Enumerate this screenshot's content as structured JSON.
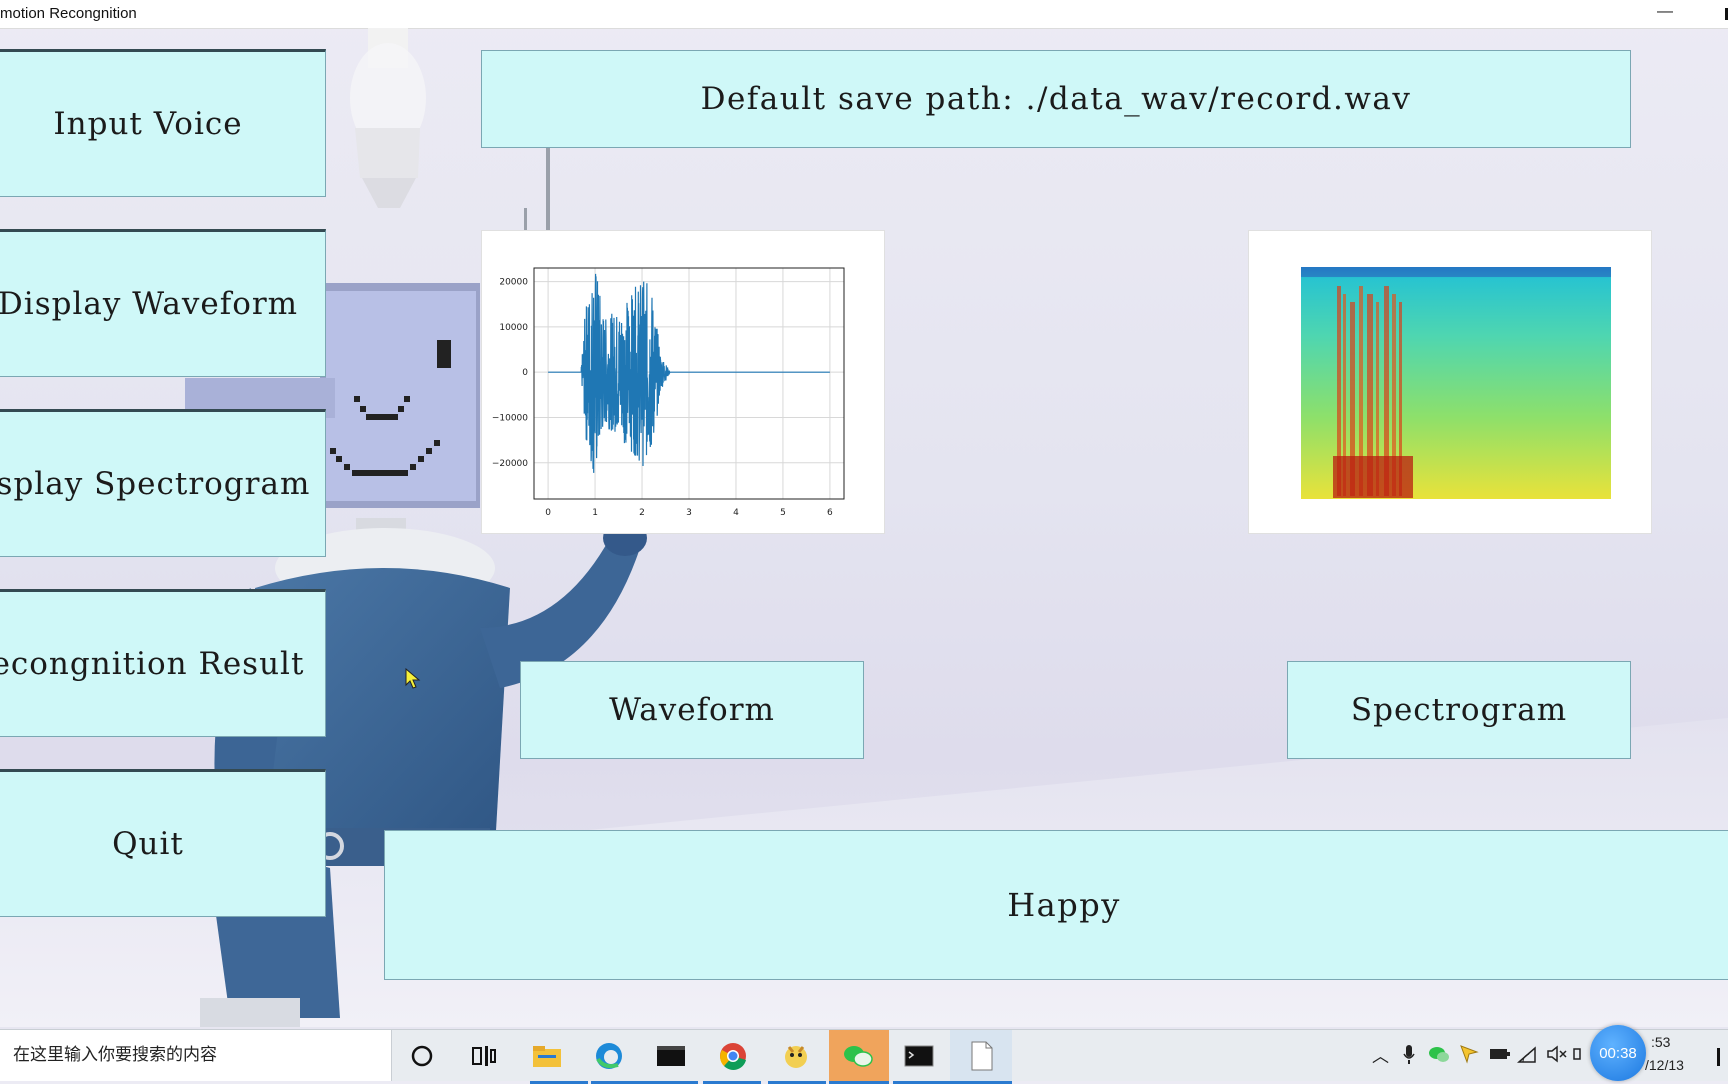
{
  "window": {
    "title": "motion Recongnition",
    "minimize_glyph": "—"
  },
  "sidebar": {
    "buttons": [
      {
        "label": "Input Voice"
      },
      {
        "label": "Display Waveform"
      },
      {
        "label": "isplay Spectrogram"
      },
      {
        "label": "econgnition Result"
      },
      {
        "label": "Quit"
      }
    ]
  },
  "path_label": "Default save path: ./data_wav/record.wav",
  "waveform_button": "Waveform",
  "spectrogram_button": "Spectrogram",
  "result_label": "Happy",
  "chart_data": {
    "type": "line",
    "title": "",
    "xlabel": "",
    "ylabel": "",
    "xlim": [
      -0.3,
      6.3
    ],
    "ylim": [
      -28000,
      23000
    ],
    "xticks": [
      "0",
      "1",
      "2",
      "3",
      "4",
      "5",
      "6"
    ],
    "yticks": [
      "20000",
      "10000",
      "0",
      "−10000",
      "−20000"
    ],
    "grid": true,
    "line_color": "#1f77b4",
    "series": [
      {
        "values_envelope": [
          {
            "x": 0.0,
            "y": 0
          },
          {
            "x": 0.7,
            "y": 0
          },
          {
            "x": 0.8,
            "y": 15000
          },
          {
            "x": 1.0,
            "y": -25000
          },
          {
            "x": 1.2,
            "y": 12000
          },
          {
            "x": 1.5,
            "y": 14000
          },
          {
            "x": 1.8,
            "y": 18000
          },
          {
            "x": 2.0,
            "y": 21000
          },
          {
            "x": 2.2,
            "y": -19000
          },
          {
            "x": 2.4,
            "y": 4000
          },
          {
            "x": 2.6,
            "y": 0
          },
          {
            "x": 6.0,
            "y": 0
          }
        ]
      }
    ]
  },
  "spectrogram": {
    "colormap": "jet"
  },
  "taskbar": {
    "search_placeholder": "在这里输入你要搜索的内容",
    "recording_time": "00:38",
    "time_partial": ":53",
    "date_partial": "/12/13"
  }
}
